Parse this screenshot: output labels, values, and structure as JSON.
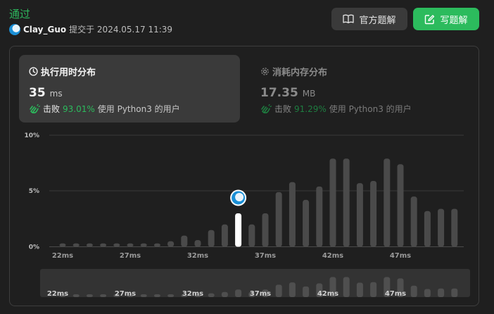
{
  "submission": {
    "status": "通过",
    "user": "Clay_Guo",
    "submitted_at": "提交于 2024.05.17 11:39"
  },
  "buttons": {
    "official_solution": "官方题解",
    "write_solution": "写题解"
  },
  "runtime": {
    "title": "执行用时分布",
    "value": "35",
    "unit": "ms",
    "beat_label": "击败",
    "beat_pct": "93.01%",
    "suffix": "使用 Python3 的用户"
  },
  "memory": {
    "title": "消耗内存分布",
    "value": "17.35",
    "unit": "MB",
    "beat_label": "击败",
    "beat_pct": "91.29%",
    "suffix": "使用 Python3 的用户"
  },
  "colors": {
    "accent_green": "#2cbb5d",
    "status_green": "#2db55d",
    "bar": "#4a4a4a",
    "bar_selected": "#ffffff"
  },
  "chart_data": {
    "type": "bar",
    "x": [
      22,
      23,
      24,
      25,
      26,
      27,
      28,
      29,
      30,
      31,
      32,
      33,
      34,
      35,
      36,
      37,
      38,
      39,
      40,
      41,
      42,
      43,
      44,
      45,
      46,
      47,
      48,
      49,
      50,
      51
    ],
    "values": [
      0.3,
      0.3,
      0.3,
      0.3,
      0.3,
      0.3,
      0.3,
      0.3,
      0.5,
      1.0,
      0.6,
      1.5,
      2.0,
      3.0,
      2.0,
      3.0,
      4.9,
      5.8,
      4.2,
      5.4,
      7.9,
      7.9,
      5.7,
      5.9,
      7.9,
      7.4,
      4.5,
      3.2,
      3.4,
      3.4
    ],
    "selected_x": 35,
    "x_ticks": [
      "22ms",
      "27ms",
      "32ms",
      "37ms",
      "42ms",
      "47ms"
    ],
    "y_ticks": [
      "10%",
      "5%",
      "0%"
    ],
    "ylim": [
      0,
      10
    ]
  }
}
